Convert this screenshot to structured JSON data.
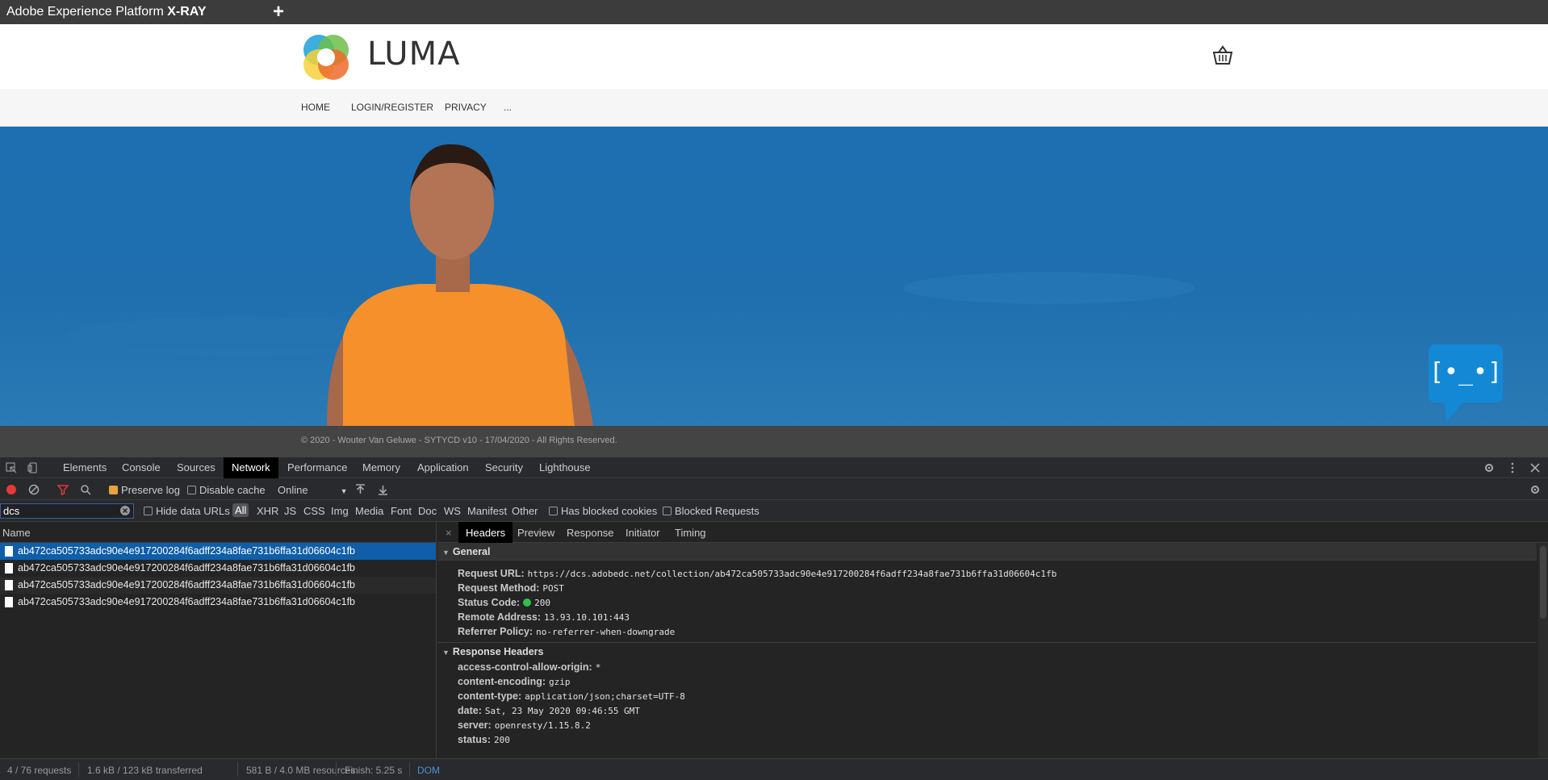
{
  "app": {
    "title_prefix": "Adobe Experience Platform ",
    "title_bold": "X-RAY",
    "new_tab": "+"
  },
  "site": {
    "brand": "LUMA",
    "nav": [
      "HOME",
      "LOGIN/REGISTER",
      "PRIVACY",
      "..."
    ],
    "footer": "© 2020 - Wouter Van Geluwe - SYTYCD v10 - 17/04/2020 - All Rights Reserved.",
    "chatbot_face": "[•_•]"
  },
  "devtools": {
    "tabs": [
      "Elements",
      "Console",
      "Sources",
      "Network",
      "Performance",
      "Memory",
      "Application",
      "Security",
      "Lighthouse"
    ],
    "active_tab": "Network",
    "toolbar": {
      "preserve_log": "Preserve log",
      "disable_cache": "Disable cache",
      "throttle": "Online"
    },
    "filter": {
      "value": "dcs",
      "hide_data_urls": "Hide data URLs",
      "types": [
        "All",
        "XHR",
        "JS",
        "CSS",
        "Img",
        "Media",
        "Font",
        "Doc",
        "WS",
        "Manifest",
        "Other"
      ],
      "has_blocked_cookies": "Has blocked cookies",
      "blocked_requests": "Blocked Requests"
    },
    "requests": {
      "header": "Name",
      "rows": [
        "ab472ca505733adc90e4e917200284f6adff234a8fae731b6ffa31d06604c1fb",
        "ab472ca505733adc90e4e917200284f6adff234a8fae731b6ffa31d06604c1fb",
        "ab472ca505733adc90e4e917200284f6adff234a8fae731b6ffa31d06604c1fb",
        "ab472ca505733adc90e4e917200284f6adff234a8fae731b6ffa31d06604c1fb"
      ]
    },
    "details": {
      "close": "×",
      "tabs": [
        "Headers",
        "Preview",
        "Response",
        "Initiator",
        "Timing"
      ],
      "general_title": "General",
      "general": {
        "url_key": "Request URL:",
        "url_val": "https://dcs.adobedc.net/collection/ab472ca505733adc90e4e917200284f6adff234a8fae731b6ffa31d06604c1fb",
        "method_key": "Request Method:",
        "method_val": "POST",
        "status_key": "Status Code:",
        "status_val": "200",
        "remote_key": "Remote Address:",
        "remote_val": "13.93.10.101:443",
        "referrer_key": "Referrer Policy:",
        "referrer_val": "no-referrer-when-downgrade"
      },
      "response_title": "Response Headers",
      "response": {
        "acao_key": "access-control-allow-origin:",
        "acao_val": "*",
        "enc_key": "content-encoding:",
        "enc_val": "gzip",
        "type_key": "content-type:",
        "type_val": "application/json;charset=UTF-8",
        "date_key": "date:",
        "date_val": "Sat, 23 May 2020 09:46:55 GMT",
        "server_key": "server:",
        "server_val": "openresty/1.15.8.2",
        "status_key": "status:",
        "status_val": "200"
      }
    },
    "status": {
      "requests": "4 / 76 requests",
      "transferred": "1.6 kB / 123 kB transferred",
      "resources": "581 B / 4.0 MB resources",
      "finish": "Finish: 5.25 s",
      "dom": "DOM"
    },
    "colors": {
      "selected_row": "#0f5ea7",
      "status_ok": "#2fbf4a",
      "record": "#e53935",
      "filter_active": "#e53935"
    }
  }
}
